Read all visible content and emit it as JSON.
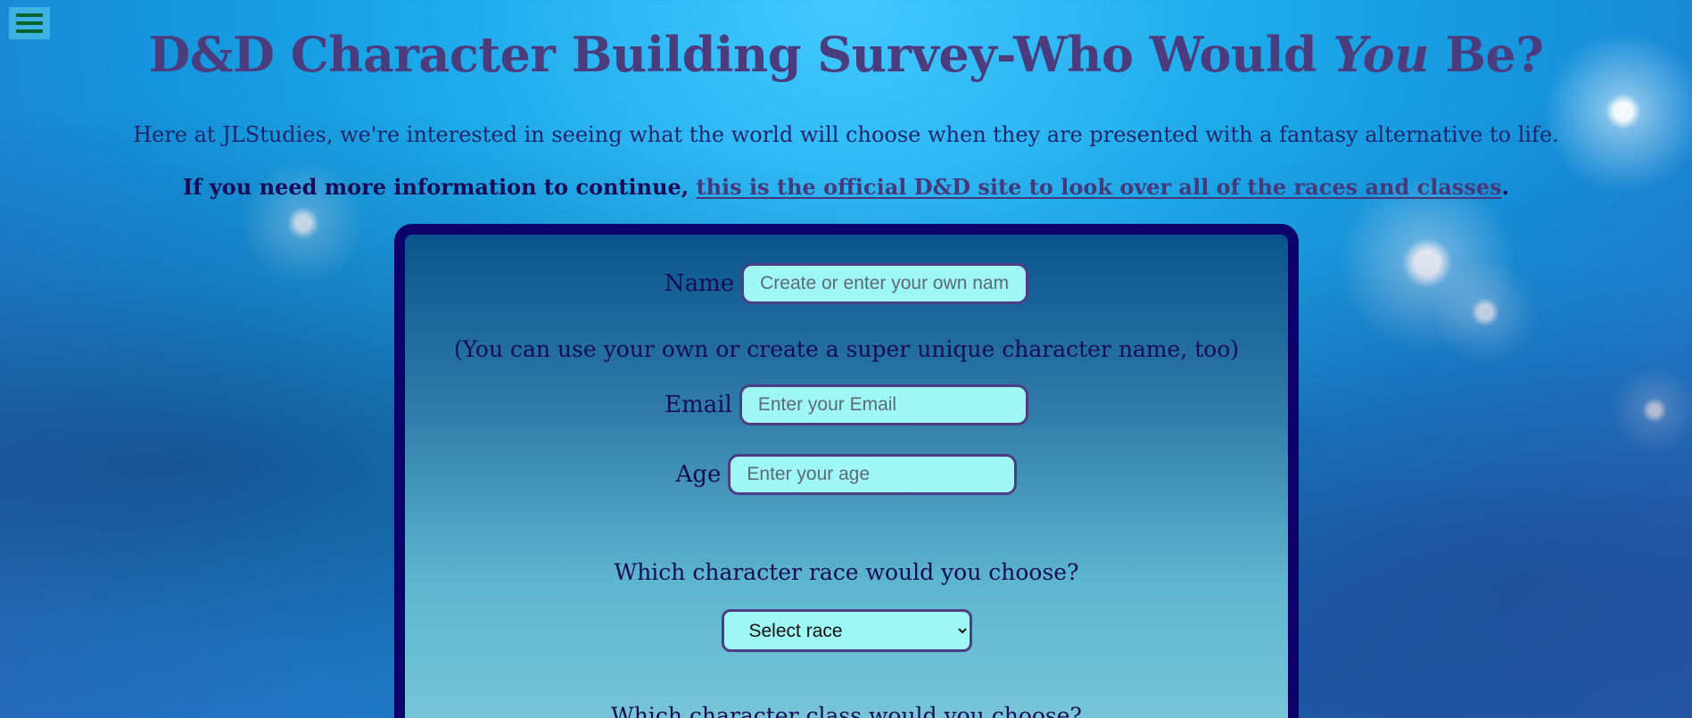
{
  "header": {
    "menu_icon": "hamburger-menu-icon",
    "title_main": "D&D Character Building Survey-Who Would",
    "title_emphasis": "You",
    "title_end": "Be?"
  },
  "intro": {
    "text": "Here at JLStudies, we're interested in seeing what the world will choose when they are presented with a fantasy alternative to life."
  },
  "info": {
    "prefix": "If you need more information to continue,",
    "link_text": "this is the official D&D site to look over all of the races and classes",
    "suffix": "."
  },
  "form": {
    "name_label": "Name",
    "name_placeholder": "Create or enter your own name",
    "name_hint": "(You can use your own or create a super unique character name, too)",
    "email_label": "Email",
    "email_placeholder": "Enter your Email",
    "age_label": "Age",
    "age_placeholder": "Enter your age",
    "race_question": "Which character race would you choose?",
    "race_selected": "Select race",
    "class_question": "Which character class would you choose?"
  },
  "colors": {
    "title": "#4b3d7d",
    "panel_border": "#0d006b",
    "field_background": "#9ef7f4",
    "field_border": "#4e3c84"
  }
}
